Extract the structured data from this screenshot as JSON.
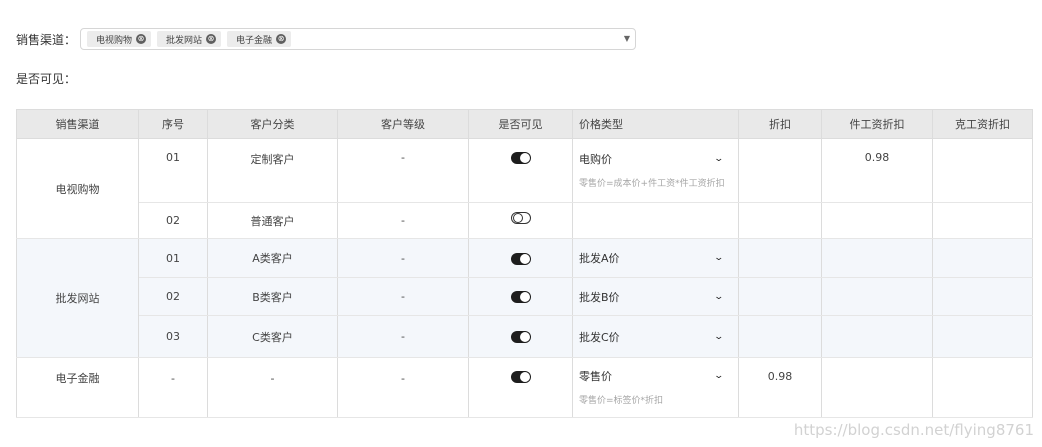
{
  "form": {
    "channel_label": "销售渠道：",
    "channel_tags": [
      "电视购物",
      "批发网站",
      "电子金融"
    ],
    "tag_close_icon": "⊗",
    "select_caret": "▼",
    "visible_label": "是否可见："
  },
  "table": {
    "headers": [
      "销售渠道",
      "序号",
      "客户分类",
      "客户等级",
      "是否可见",
      "价格类型",
      "折扣",
      "件工资折扣",
      "克工资折扣"
    ],
    "groups": [
      {
        "channel": "电视购物"
      },
      {
        "channel": "批发网站"
      },
      {
        "channel": "电子金融"
      }
    ],
    "rows": [
      {
        "seq": "01",
        "category": "定制客户",
        "level": "-",
        "visible": true,
        "price_type": "电购价",
        "formula": "零售价=成本价+件工资*件工资折扣",
        "discount": "",
        "piece_discount": "0.98",
        "gram_discount": ""
      },
      {
        "seq": "02",
        "category": "普通客户",
        "level": "-",
        "visible": false,
        "price_type": "",
        "formula": "",
        "discount": "",
        "piece_discount": "",
        "gram_discount": ""
      },
      {
        "seq": "01",
        "category": "A类客户",
        "level": "-",
        "visible": true,
        "price_type": "批发A价",
        "formula": "",
        "discount": "",
        "piece_discount": "",
        "gram_discount": ""
      },
      {
        "seq": "02",
        "category": "B类客户",
        "level": "-",
        "visible": true,
        "price_type": "批发B价",
        "formula": "",
        "discount": "",
        "piece_discount": "",
        "gram_discount": ""
      },
      {
        "seq": "03",
        "category": "C类客户",
        "level": "-",
        "visible": true,
        "price_type": "批发C价",
        "formula": "",
        "discount": "",
        "piece_discount": "",
        "gram_discount": ""
      },
      {
        "seq": "-",
        "category": "-",
        "level": "-",
        "visible": true,
        "price_type": "零售价",
        "formula": "零售价=标签价*折扣",
        "discount": "0.98",
        "piece_discount": "",
        "gram_discount": ""
      }
    ],
    "chevron_icon": "⌄"
  },
  "watermark": "https://blog.csdn.net/flying8761"
}
